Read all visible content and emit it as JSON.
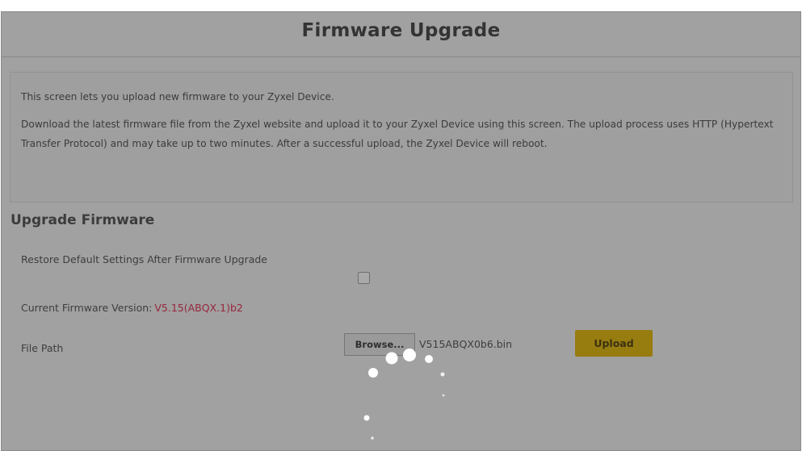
{
  "page": {
    "title": "Firmware Upgrade"
  },
  "info": {
    "line1": "This screen lets you upload new firmware to your Zyxel Device.",
    "line2": "Download the latest firmware file from the Zyxel website and upload it to your Zyxel Device using this screen. The upload process uses HTTP (Hypertext Transfer Protocol) and may take up to two minutes. After a successful upload, the Zyxel Device will reboot."
  },
  "upgrade_section": {
    "title": "Upgrade Firmware",
    "restore_label": "Restore Default Settings After Firmware Upgrade",
    "restore_checked": false,
    "current_version_label": "Current Firmware Version:",
    "current_version_value": "V5.15(ABQX.1)b2",
    "file_path_label": "File Path",
    "browse_label": "Browse...",
    "selected_file": "V515ABQX0b6.bin",
    "upload_label": "Upload"
  },
  "colors": {
    "accent": "#e2b400",
    "version_text": "#e0264a"
  },
  "loading": {
    "spinner_icon": "loading-spinner-icon"
  }
}
